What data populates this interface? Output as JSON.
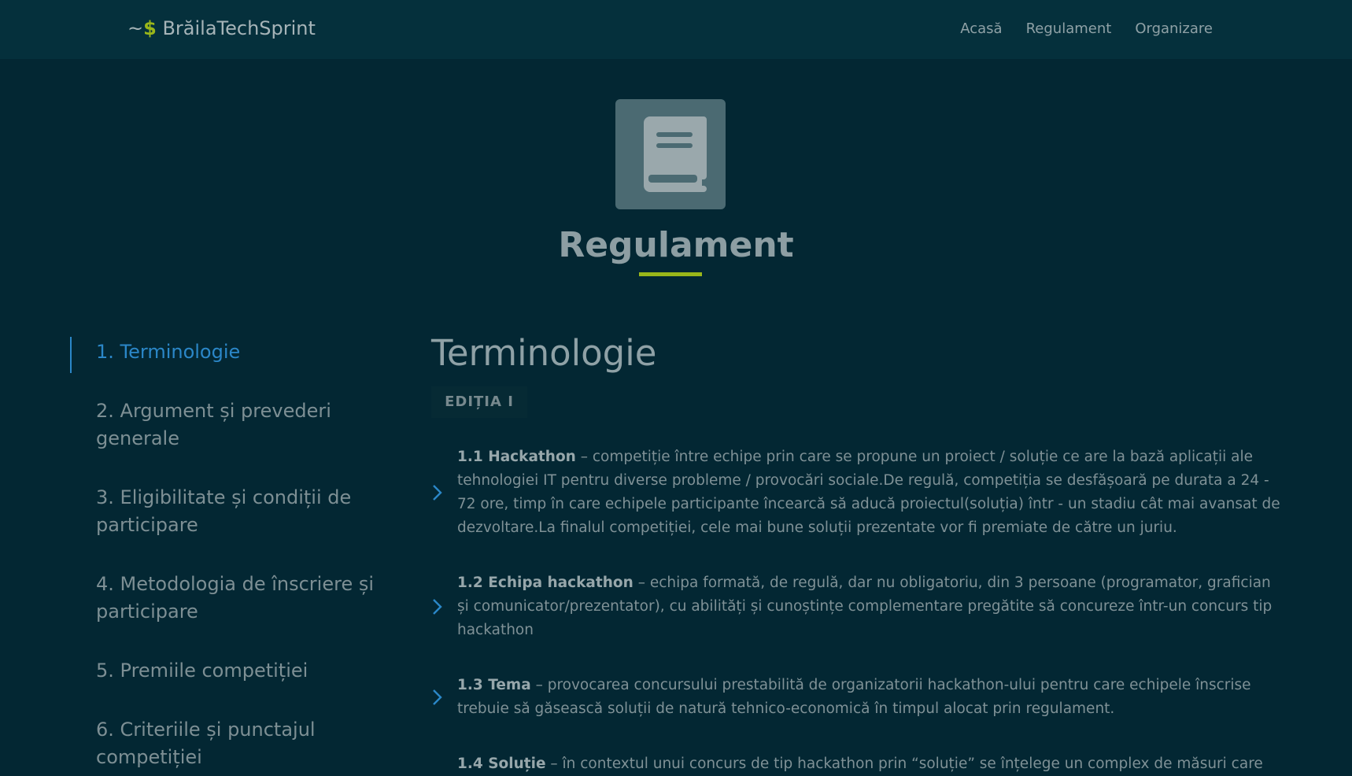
{
  "brand": {
    "prompt": "~",
    "dollar": "$",
    "name": " BrăilaTechSprint"
  },
  "nav": {
    "items": [
      "Acasă",
      "Regulament",
      "Organizare"
    ]
  },
  "hero": {
    "icon": "book-icon",
    "title": "Regulament"
  },
  "colors": {
    "accent": "#9ab61a",
    "link_active": "#2b87c8",
    "background": "#032733"
  },
  "sidebar": {
    "items": [
      {
        "label": "1. Terminologie",
        "active": true
      },
      {
        "label": "2. Argument și prevederi generale",
        "active": false
      },
      {
        "label": "3. Eligibilitate și condiții de participare",
        "active": false
      },
      {
        "label": "4. Metodologia de înscriere și participare",
        "active": false
      },
      {
        "label": "5. Premiile competiției",
        "active": false
      },
      {
        "label": "6. Criteriile și punctajul competiției",
        "active": false
      }
    ]
  },
  "main": {
    "section_title": "Terminologie",
    "edition": "EDIȚIA I",
    "terms": [
      {
        "term": "1.1 Hackathon",
        "text": " – competiție între echipe prin care se propune un proiect / soluție ce are la bază aplicații ale tehnologiei IT pentru diverse probleme / provocări sociale.De regulă, competiția se desfășoară pe durata a 24 - 72 ore, timp în care echipele participante încearcă să aducă proiectul(soluția) într - un stadiu cât mai avansat de dezvoltare.La finalul competiției, cele mai bune soluții prezentate vor fi premiate de către un juriu."
      },
      {
        "term": "1.2 Echipa hackathon",
        "text": " – echipa formată, de regulă, dar nu obligatoriu, din 3 persoane (programator, grafician și comunicator/prezentator), cu abilități și cunoștințe complementare pregătite să concureze într-un concurs tip hackathon"
      },
      {
        "term": "1.3 Tema",
        "text": " – provocarea concursului prestabilită de organizatorii hackathon-ului pentru care echipele înscrise trebuie să găsească soluții de natură tehnico-economică în timpul alocat prin regulament."
      },
      {
        "term": "1.4 Soluție",
        "text": " – în contextul unui concurs de tip hackathon prin “soluție” se înțelege un complex de măsuri care"
      }
    ]
  }
}
